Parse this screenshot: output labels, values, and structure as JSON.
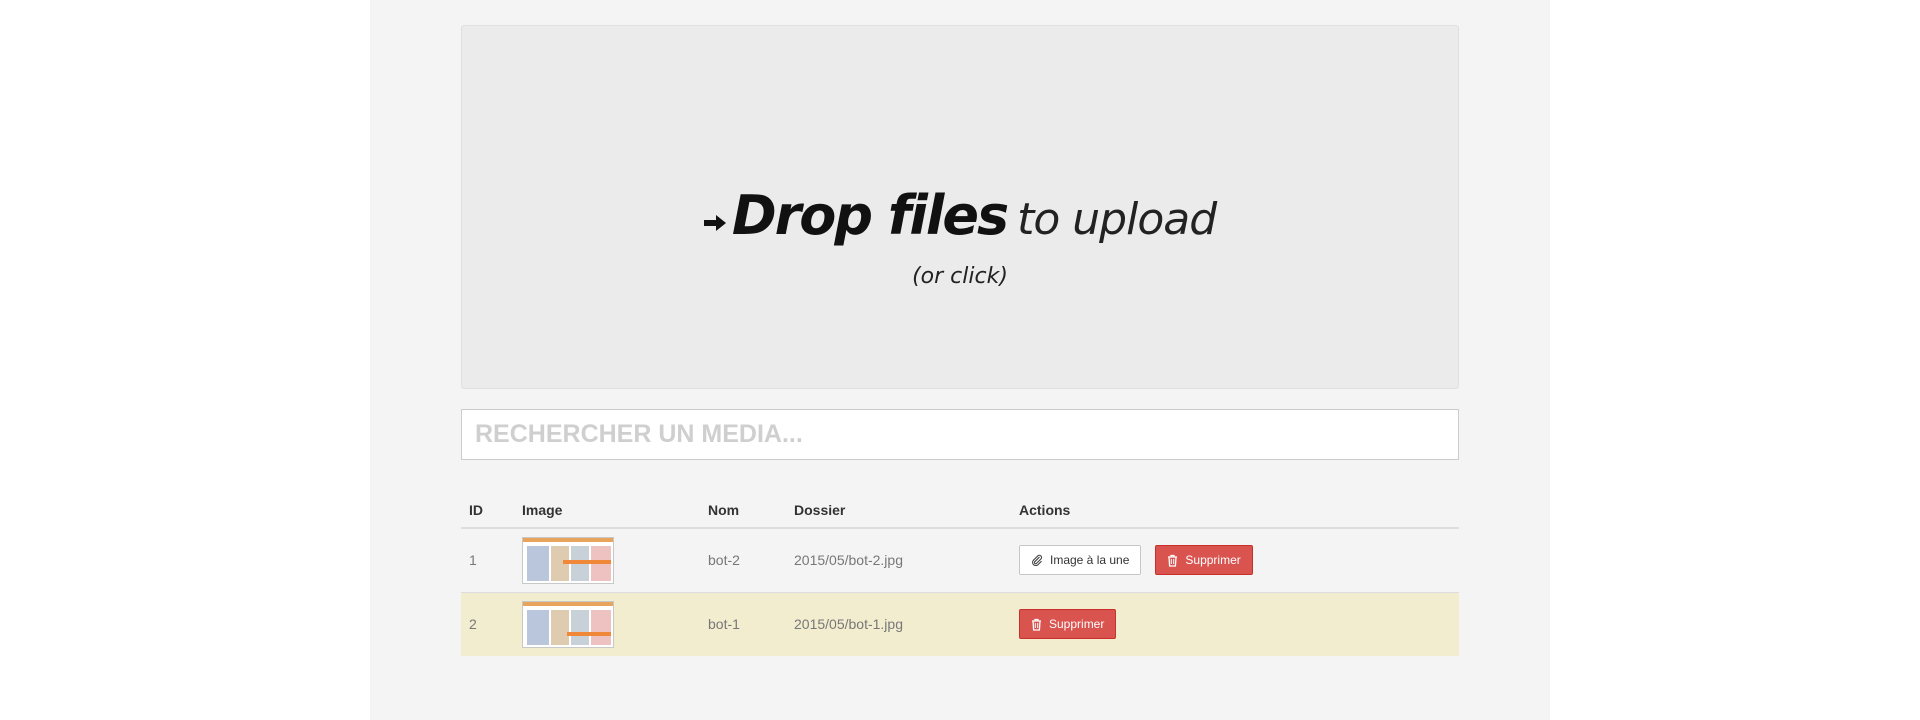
{
  "dropzone": {
    "headline_strong": "Drop files",
    "headline_light": "to upload",
    "subline": "(or click)"
  },
  "search": {
    "placeholder": "RECHERCHER UN MEDIA..."
  },
  "table": {
    "headers": {
      "id": "ID",
      "image": "Image",
      "name": "Nom",
      "folder": "Dossier",
      "actions": "Actions"
    },
    "rows": [
      {
        "id": "1",
        "name": "bot-2",
        "folder": "2015/05/bot-2.jpg",
        "featured_label": "Image à la une",
        "delete_label": "Supprimer",
        "highlighted": false
      },
      {
        "id": "2",
        "name": "bot-1",
        "folder": "2015/05/bot-1.jpg",
        "delete_label": "Supprimer",
        "highlighted": true
      }
    ]
  },
  "colors": {
    "page_bg": "#f4f4f4",
    "dropzone_bg": "#ebebeb",
    "danger": "#d9534f",
    "row_highlight": "#f3edcf"
  },
  "icons": {
    "dropzone": "arrow-right-icon",
    "featured": "paperclip-icon",
    "delete": "trash-icon"
  }
}
